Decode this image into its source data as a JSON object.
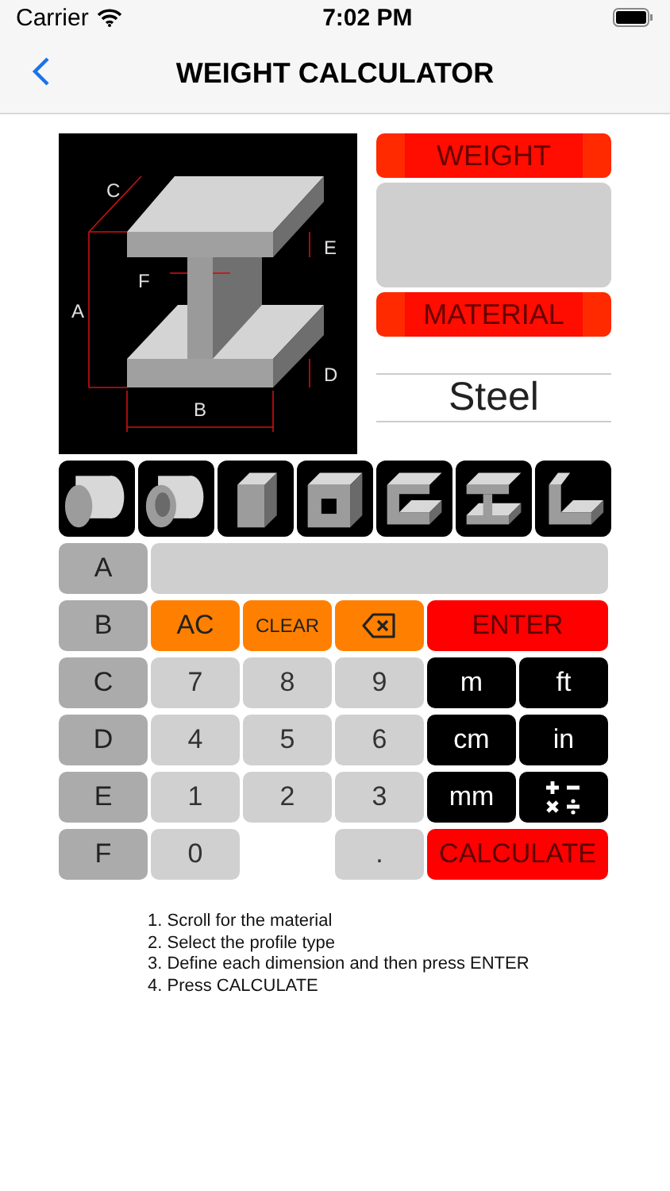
{
  "status_bar": {
    "carrier": "Carrier",
    "time": "7:02 PM"
  },
  "nav": {
    "title": "WEIGHT CALCULATOR"
  },
  "diagram": {
    "labels": [
      {
        "kind": "C",
        "text": "C"
      },
      {
        "kind": "E",
        "text": "E"
      },
      {
        "kind": "F",
        "text": "F"
      },
      {
        "kind": "A",
        "text": "A"
      },
      {
        "kind": "D",
        "text": "D"
      },
      {
        "kind": "B",
        "text": "B"
      }
    ]
  },
  "weight_button": "WEIGHT",
  "material_button": "MATERIAL",
  "material_picker": {
    "selected_value": "Steel"
  },
  "profiles": [
    {
      "kind": "round"
    },
    {
      "kind": "tube"
    },
    {
      "kind": "square"
    },
    {
      "kind": "box"
    },
    {
      "kind": "channel"
    },
    {
      "kind": "ibeam"
    },
    {
      "kind": "angle"
    }
  ],
  "keypad": [
    {
      "label": "A",
      "keys": [
        {
          "kind": "display"
        }
      ]
    },
    {
      "label": "B",
      "keys": [
        {
          "kind": "action",
          "text": "AC"
        },
        {
          "kind": "action-small",
          "text": "CLEAR"
        },
        {
          "kind": "backspace"
        },
        {
          "kind": "enter",
          "text": "ENTER"
        }
      ]
    },
    {
      "label": "C",
      "keys": [
        {
          "kind": "digit",
          "text": "7"
        },
        {
          "kind": "digit",
          "text": "8"
        },
        {
          "kind": "digit",
          "text": "9"
        },
        {
          "kind": "unit",
          "text": "m"
        },
        {
          "kind": "unit",
          "text": "ft"
        }
      ]
    },
    {
      "label": "D",
      "keys": [
        {
          "kind": "digit",
          "text": "4"
        },
        {
          "kind": "digit",
          "text": "5"
        },
        {
          "kind": "digit",
          "text": "6"
        },
        {
          "kind": "unit",
          "text": "cm"
        },
        {
          "kind": "unit",
          "text": "in"
        }
      ]
    },
    {
      "label": "E",
      "keys": [
        {
          "kind": "digit",
          "text": "1"
        },
        {
          "kind": "digit",
          "text": "2"
        },
        {
          "kind": "digit",
          "text": "3"
        },
        {
          "kind": "unit",
          "text": "mm"
        },
        {
          "kind": "operators"
        }
      ]
    },
    {
      "label": "F",
      "keys": [
        {
          "kind": "digit",
          "text": "0"
        },
        {
          "kind": "empty"
        },
        {
          "kind": "digit",
          "text": "."
        },
        {
          "kind": "calculate",
          "text": "CALCULATE"
        }
      ]
    }
  ],
  "instructions": [
    "1. Scroll for the material",
    "2. Select the profile type",
    "3. Define each dimension and then press ENTER",
    "4. Press CALCULATE"
  ]
}
